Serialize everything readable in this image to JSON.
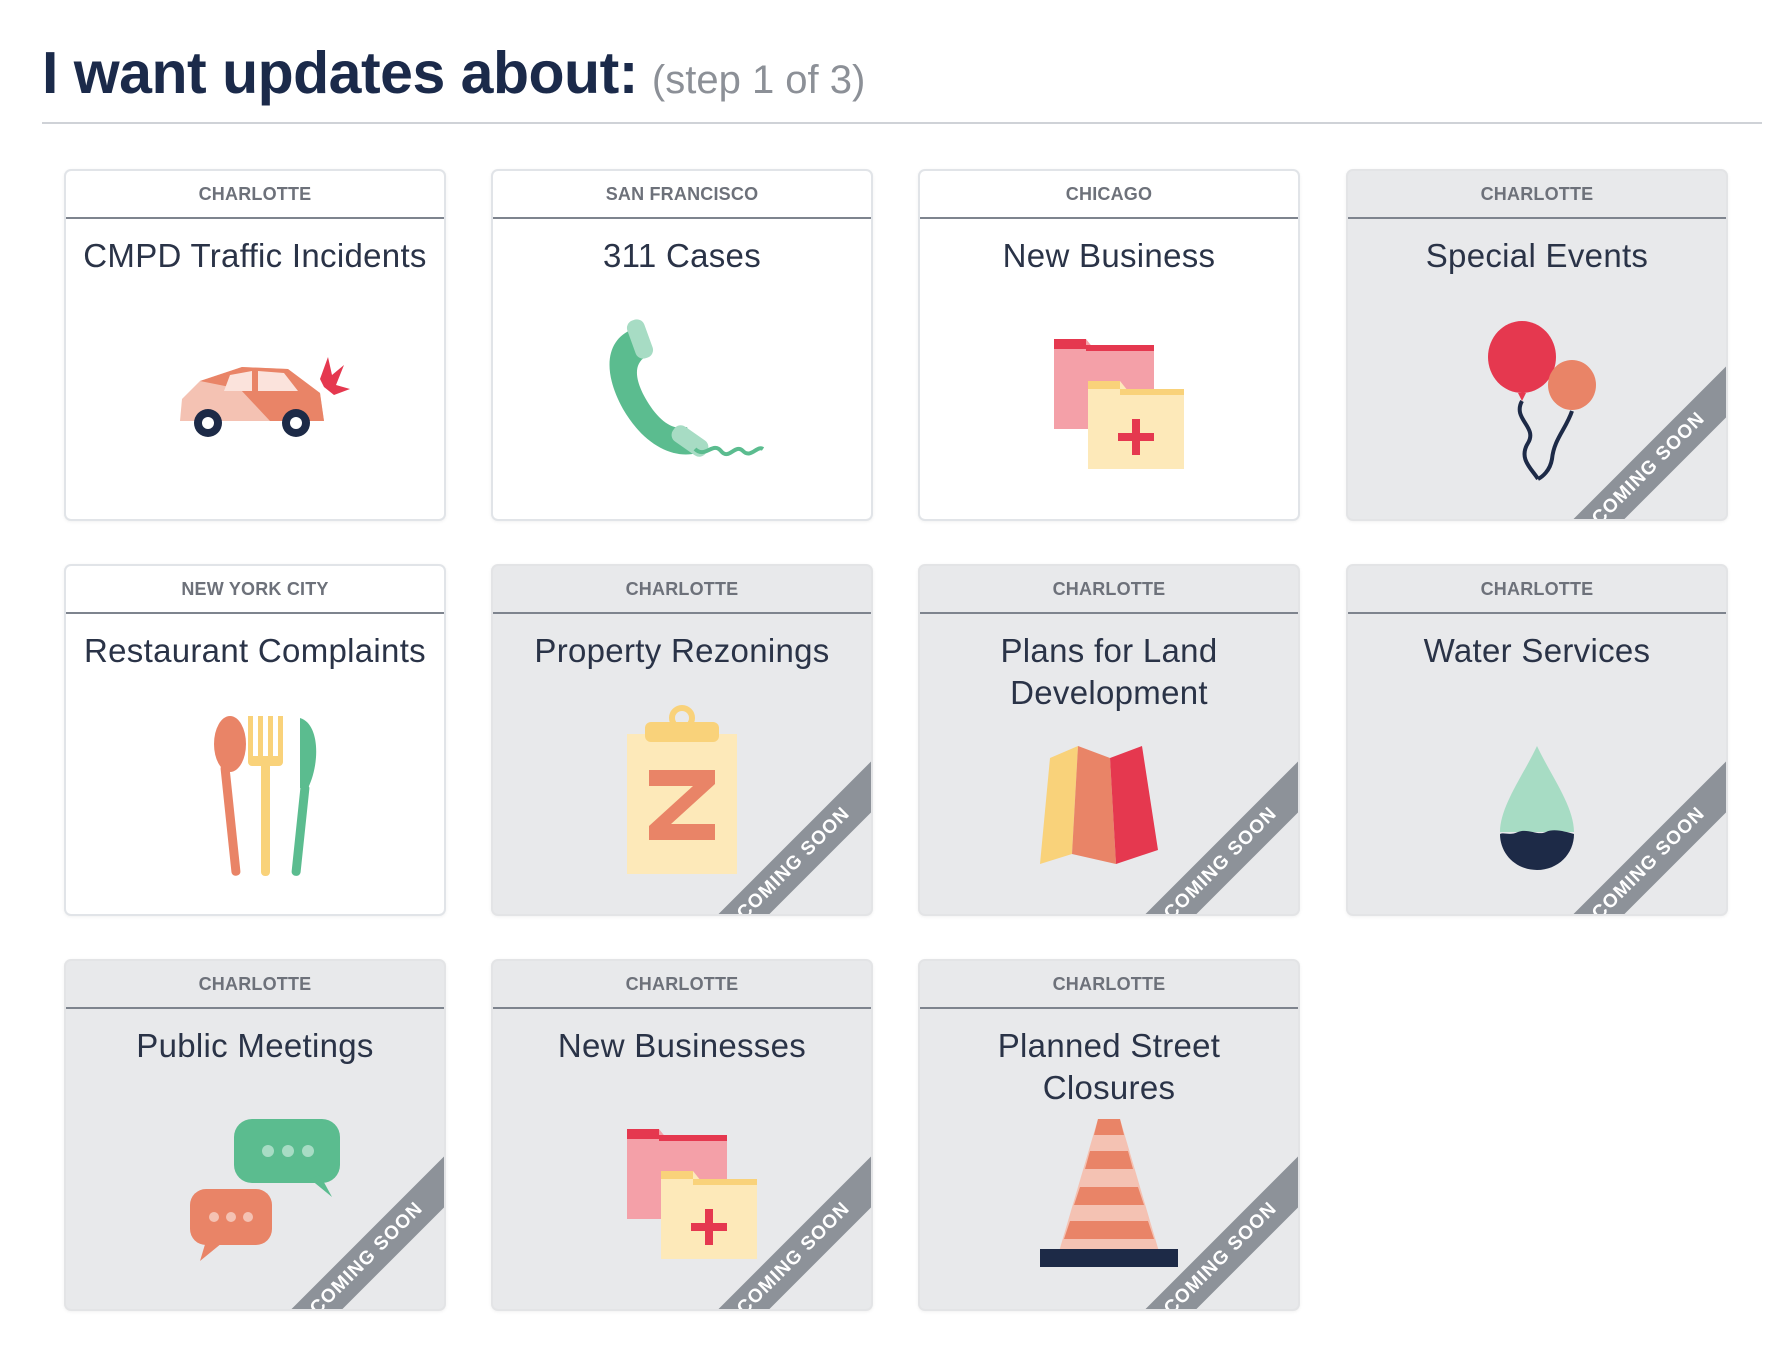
{
  "header": {
    "title": "I want updates about:",
    "step": "(step 1 of 3)"
  },
  "ribbon_label": "COMING SOON",
  "cards": [
    {
      "city": "CHARLOTTE",
      "name": "CMPD Traffic Incidents",
      "icon": "car-crash-icon",
      "coming_soon": false
    },
    {
      "city": "SAN FRANCISCO",
      "name": "311 Cases",
      "icon": "telephone-icon",
      "coming_soon": false
    },
    {
      "city": "CHICAGO",
      "name": "New Business",
      "icon": "folder-add-icon",
      "coming_soon": false
    },
    {
      "city": "CHARLOTTE",
      "name": "Special Events",
      "icon": "balloons-icon",
      "coming_soon": true
    },
    {
      "city": "NEW YORK CITY",
      "name": "Restaurant Complaints",
      "icon": "utensils-icon",
      "coming_soon": false
    },
    {
      "city": "CHARLOTTE",
      "name": "Property Rezonings",
      "icon": "clipboard-z-icon",
      "coming_soon": true
    },
    {
      "city": "CHARLOTTE",
      "name": "Plans for Land Development",
      "icon": "map-icon",
      "coming_soon": true
    },
    {
      "city": "CHARLOTTE",
      "name": "Water Services",
      "icon": "water-drop-icon",
      "coming_soon": true
    },
    {
      "city": "CHARLOTTE",
      "name": "Public Meetings",
      "icon": "chat-bubbles-icon",
      "coming_soon": true
    },
    {
      "city": "CHARLOTTE",
      "name": "New Businesses",
      "icon": "folder-add-icon",
      "coming_soon": true
    },
    {
      "city": "CHARLOTTE",
      "name": "Planned Street Closures",
      "icon": "traffic-cone-icon",
      "coming_soon": true
    }
  ],
  "colors": {
    "title": "#1b2a4a",
    "step": "#8c9097",
    "city": "#6d717a",
    "coming_soon_card": "#e8e9eb",
    "ribbon": "#8d9299"
  }
}
